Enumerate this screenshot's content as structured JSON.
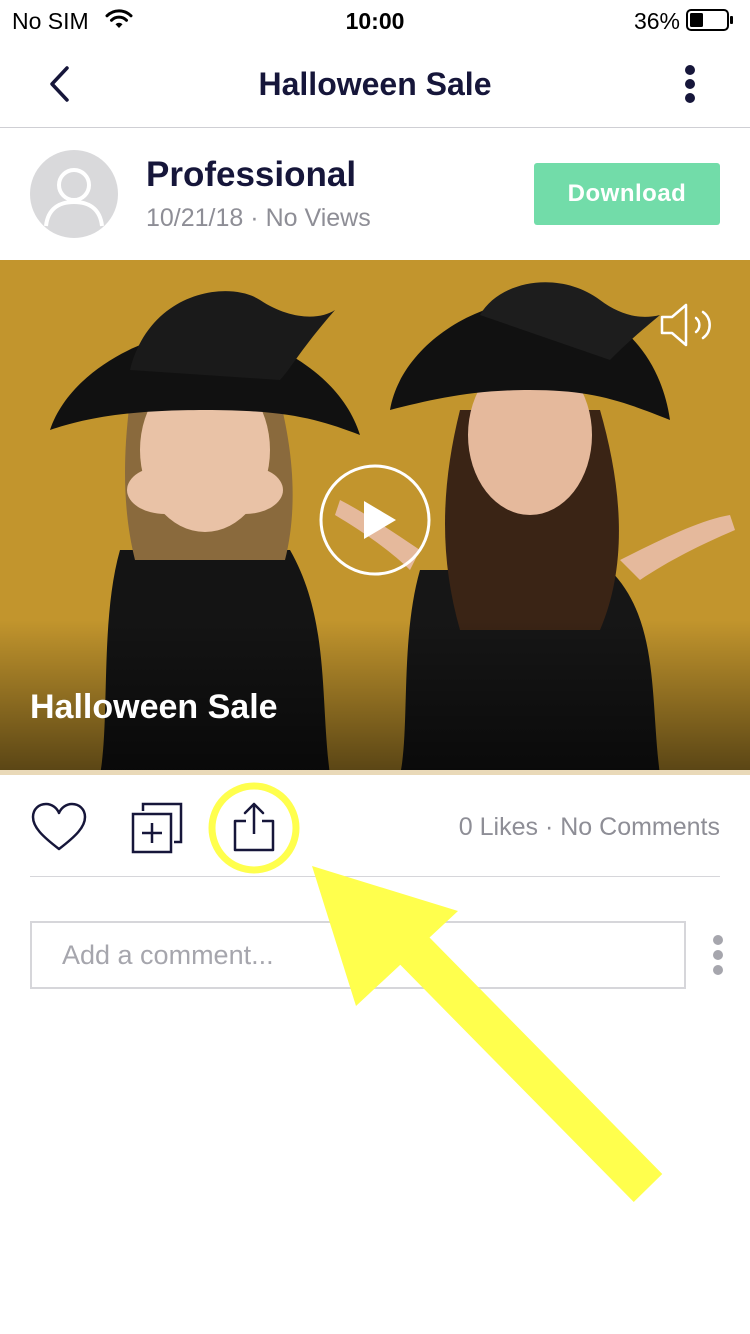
{
  "status_bar": {
    "carrier": "No SIM",
    "time": "10:00",
    "battery_percent": "36%",
    "battery_level": 0.36,
    "icons": [
      "wifi-icon",
      "battery-icon"
    ]
  },
  "nav": {
    "title": "Halloween Sale",
    "back_icon": "chevron-left-icon",
    "more_icon": "vertical-ellipsis-icon"
  },
  "post": {
    "author": "Professional",
    "date": "10/21/18",
    "views": "No Views",
    "download_label": "Download",
    "avatar_icon": "user-silhouette-icon"
  },
  "media": {
    "caption": "Halloween Sale",
    "background_color": "#c2952d",
    "icons": [
      "speaker-icon",
      "play-icon"
    ],
    "progress": 0
  },
  "actions": {
    "likes": "0 Likes",
    "comments": "No Comments",
    "icons": [
      "heart-icon",
      "add-to-collection-icon",
      "share-icon"
    ]
  },
  "comment": {
    "placeholder": "Add a comment...",
    "more_icon": "vertical-ellipsis-icon"
  },
  "colors": {
    "primary_text": "#16163a",
    "secondary_text": "#8e8e96",
    "accent": "#72dca9",
    "annotation": "#ffff4d"
  }
}
